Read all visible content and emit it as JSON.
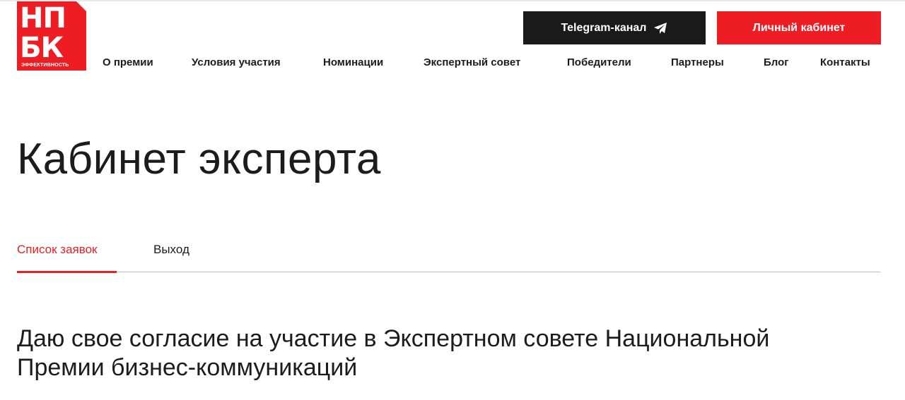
{
  "logo": {
    "line1": "НП",
    "line2": "БК",
    "subtitle": "эффективность"
  },
  "header": {
    "telegram_label": "Telegram-канал",
    "cabinet_label": "Личный кабинет"
  },
  "nav": {
    "items": [
      {
        "label": "О премии"
      },
      {
        "label": "Условия участия"
      },
      {
        "label": "Номинации"
      },
      {
        "label": "Экспертный совет"
      },
      {
        "label": "Победители"
      },
      {
        "label": "Партнеры"
      },
      {
        "label": "Блог"
      },
      {
        "label": "Контакты"
      }
    ]
  },
  "page": {
    "title": "Кабинет эксперта",
    "tabs": [
      {
        "label": "Список заявок",
        "active": true
      },
      {
        "label": "Выход",
        "active": false
      }
    ],
    "consent_text": "Даю свое согласие на участие в Экспертном совете Национальной Премии бизнес-коммуникаций"
  },
  "colors": {
    "accent": "#ee1d23",
    "dark_button": "#1a1a1a"
  },
  "icons": {
    "telegram": "paper-plane-icon"
  }
}
